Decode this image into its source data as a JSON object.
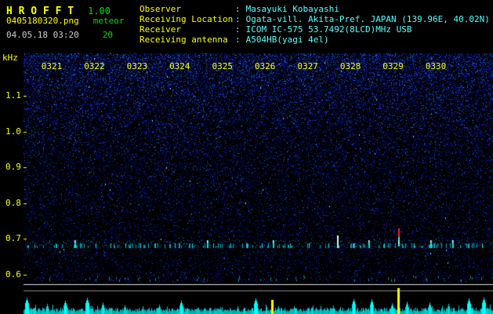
{
  "app": {
    "title": "H R O F F T",
    "version": "1.00",
    "filename": "0405180320.png",
    "mode": "meteor",
    "datetime": "04.05.18 03:20",
    "count": "20"
  },
  "info": {
    "sep": ":",
    "rows": [
      {
        "label": "Observer",
        "value": "Masayuki Kobayashi"
      },
      {
        "label": "Receiving Location",
        "value": "Ogata-vill. Akita-Pref. JAPAN (139.96E, 40.02N)"
      },
      {
        "label": "Receiver",
        "value": "ICOM IC-575 53.7492(8LCD)MHz USB"
      },
      {
        "label": "Receiving antenna",
        "value": "A504HB(yagi 4el)"
      }
    ]
  },
  "colors": {
    "label_yellow": "#ffff00",
    "value_cyan": "#55ffff",
    "status_green": "#00dd00",
    "noise_blue": "#001a94",
    "echo_cyan": "#00e8e8",
    "alert_red": "#ff2222",
    "spike_yellow": "#ffff00",
    "separator_white": "#e0e0e0"
  },
  "chart_data": {
    "type": "heatmap",
    "title": "HROFFT 10-minute meteor echo spectrogram, upper panel frequency vs time, lower strip relative signal level",
    "x_ticks": [
      "0321",
      "0322",
      "0323",
      "0324",
      "0325",
      "0326",
      "0327",
      "0328",
      "0329",
      "0330"
    ],
    "x_range": [
      "03:20",
      "03:31"
    ],
    "y_unit": "kHz",
    "y_ticks": [
      "1.1",
      "1.0",
      "0.9",
      "0.8",
      "0.7",
      "0.6"
    ],
    "y_range_khz": [
      0.55,
      1.15
    ],
    "echo_band_khz": 0.7,
    "grid": false,
    "echoes": [
      {
        "m": 0.6,
        "s": 1
      },
      {
        "m": 1.05,
        "s": 2
      },
      {
        "m": 1.18,
        "s": 1
      },
      {
        "m": 1.55,
        "s": 1
      },
      {
        "m": 1.9,
        "s": 1
      },
      {
        "m": 2.25,
        "s": 1
      },
      {
        "m": 2.6,
        "s": 1
      },
      {
        "m": 2.95,
        "s": 1
      },
      {
        "m": 3.4,
        "s": 1
      },
      {
        "m": 3.8,
        "s": 1
      },
      {
        "m": 4.15,
        "s": 2
      },
      {
        "m": 4.3,
        "s": 1
      },
      {
        "m": 4.7,
        "s": 1
      },
      {
        "m": 5.1,
        "s": 1
      },
      {
        "m": 5.45,
        "s": 1
      },
      {
        "m": 5.7,
        "s": 2
      },
      {
        "m": 6.1,
        "s": 1
      },
      {
        "m": 6.55,
        "s": 1
      },
      {
        "m": 7.0,
        "s": 1
      },
      {
        "m": 7.2,
        "s": 3
      },
      {
        "m": 7.6,
        "s": 1
      },
      {
        "m": 7.95,
        "s": 2
      },
      {
        "m": 8.3,
        "s": 1
      },
      {
        "m": 8.64,
        "s": 3,
        "red": true
      },
      {
        "m": 9.0,
        "s": 1
      },
      {
        "m": 9.4,
        "s": 2
      },
      {
        "m": 9.9,
        "s": 2
      },
      {
        "m": 10.3,
        "s": 1
      },
      {
        "m": 10.6,
        "s": 1
      }
    ],
    "bottom_spikes": [
      {
        "m": 5.68,
        "h": 18,
        "color": "yellow"
      },
      {
        "m": 8.64,
        "h": 33,
        "color": "yellow"
      }
    ]
  }
}
